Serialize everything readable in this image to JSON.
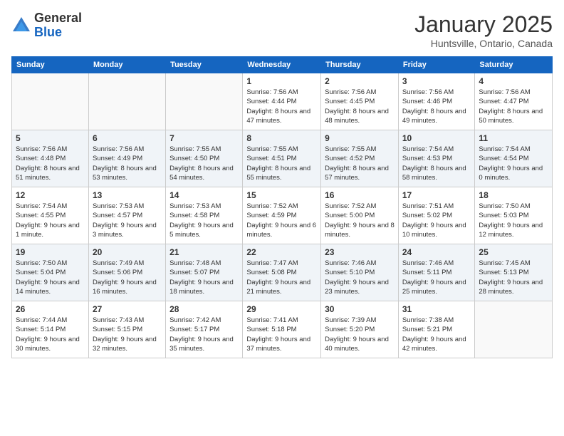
{
  "logo": {
    "general": "General",
    "blue": "Blue"
  },
  "header": {
    "month": "January 2025",
    "location": "Huntsville, Ontario, Canada"
  },
  "weekdays": [
    "Sunday",
    "Monday",
    "Tuesday",
    "Wednesday",
    "Thursday",
    "Friday",
    "Saturday"
  ],
  "weeks": [
    [
      {
        "day": "",
        "info": ""
      },
      {
        "day": "",
        "info": ""
      },
      {
        "day": "",
        "info": ""
      },
      {
        "day": "1",
        "info": "Sunrise: 7:56 AM\nSunset: 4:44 PM\nDaylight: 8 hours and 47 minutes."
      },
      {
        "day": "2",
        "info": "Sunrise: 7:56 AM\nSunset: 4:45 PM\nDaylight: 8 hours and 48 minutes."
      },
      {
        "day": "3",
        "info": "Sunrise: 7:56 AM\nSunset: 4:46 PM\nDaylight: 8 hours and 49 minutes."
      },
      {
        "day": "4",
        "info": "Sunrise: 7:56 AM\nSunset: 4:47 PM\nDaylight: 8 hours and 50 minutes."
      }
    ],
    [
      {
        "day": "5",
        "info": "Sunrise: 7:56 AM\nSunset: 4:48 PM\nDaylight: 8 hours and 51 minutes."
      },
      {
        "day": "6",
        "info": "Sunrise: 7:56 AM\nSunset: 4:49 PM\nDaylight: 8 hours and 53 minutes."
      },
      {
        "day": "7",
        "info": "Sunrise: 7:55 AM\nSunset: 4:50 PM\nDaylight: 8 hours and 54 minutes."
      },
      {
        "day": "8",
        "info": "Sunrise: 7:55 AM\nSunset: 4:51 PM\nDaylight: 8 hours and 55 minutes."
      },
      {
        "day": "9",
        "info": "Sunrise: 7:55 AM\nSunset: 4:52 PM\nDaylight: 8 hours and 57 minutes."
      },
      {
        "day": "10",
        "info": "Sunrise: 7:54 AM\nSunset: 4:53 PM\nDaylight: 8 hours and 58 minutes."
      },
      {
        "day": "11",
        "info": "Sunrise: 7:54 AM\nSunset: 4:54 PM\nDaylight: 9 hours and 0 minutes."
      }
    ],
    [
      {
        "day": "12",
        "info": "Sunrise: 7:54 AM\nSunset: 4:55 PM\nDaylight: 9 hours and 1 minute."
      },
      {
        "day": "13",
        "info": "Sunrise: 7:53 AM\nSunset: 4:57 PM\nDaylight: 9 hours and 3 minutes."
      },
      {
        "day": "14",
        "info": "Sunrise: 7:53 AM\nSunset: 4:58 PM\nDaylight: 9 hours and 5 minutes."
      },
      {
        "day": "15",
        "info": "Sunrise: 7:52 AM\nSunset: 4:59 PM\nDaylight: 9 hours and 6 minutes."
      },
      {
        "day": "16",
        "info": "Sunrise: 7:52 AM\nSunset: 5:00 PM\nDaylight: 9 hours and 8 minutes."
      },
      {
        "day": "17",
        "info": "Sunrise: 7:51 AM\nSunset: 5:02 PM\nDaylight: 9 hours and 10 minutes."
      },
      {
        "day": "18",
        "info": "Sunrise: 7:50 AM\nSunset: 5:03 PM\nDaylight: 9 hours and 12 minutes."
      }
    ],
    [
      {
        "day": "19",
        "info": "Sunrise: 7:50 AM\nSunset: 5:04 PM\nDaylight: 9 hours and 14 minutes."
      },
      {
        "day": "20",
        "info": "Sunrise: 7:49 AM\nSunset: 5:06 PM\nDaylight: 9 hours and 16 minutes."
      },
      {
        "day": "21",
        "info": "Sunrise: 7:48 AM\nSunset: 5:07 PM\nDaylight: 9 hours and 18 minutes."
      },
      {
        "day": "22",
        "info": "Sunrise: 7:47 AM\nSunset: 5:08 PM\nDaylight: 9 hours and 21 minutes."
      },
      {
        "day": "23",
        "info": "Sunrise: 7:46 AM\nSunset: 5:10 PM\nDaylight: 9 hours and 23 minutes."
      },
      {
        "day": "24",
        "info": "Sunrise: 7:46 AM\nSunset: 5:11 PM\nDaylight: 9 hours and 25 minutes."
      },
      {
        "day": "25",
        "info": "Sunrise: 7:45 AM\nSunset: 5:13 PM\nDaylight: 9 hours and 28 minutes."
      }
    ],
    [
      {
        "day": "26",
        "info": "Sunrise: 7:44 AM\nSunset: 5:14 PM\nDaylight: 9 hours and 30 minutes."
      },
      {
        "day": "27",
        "info": "Sunrise: 7:43 AM\nSunset: 5:15 PM\nDaylight: 9 hours and 32 minutes."
      },
      {
        "day": "28",
        "info": "Sunrise: 7:42 AM\nSunset: 5:17 PM\nDaylight: 9 hours and 35 minutes."
      },
      {
        "day": "29",
        "info": "Sunrise: 7:41 AM\nSunset: 5:18 PM\nDaylight: 9 hours and 37 minutes."
      },
      {
        "day": "30",
        "info": "Sunrise: 7:39 AM\nSunset: 5:20 PM\nDaylight: 9 hours and 40 minutes."
      },
      {
        "day": "31",
        "info": "Sunrise: 7:38 AM\nSunset: 5:21 PM\nDaylight: 9 hours and 42 minutes."
      },
      {
        "day": "",
        "info": ""
      }
    ]
  ]
}
